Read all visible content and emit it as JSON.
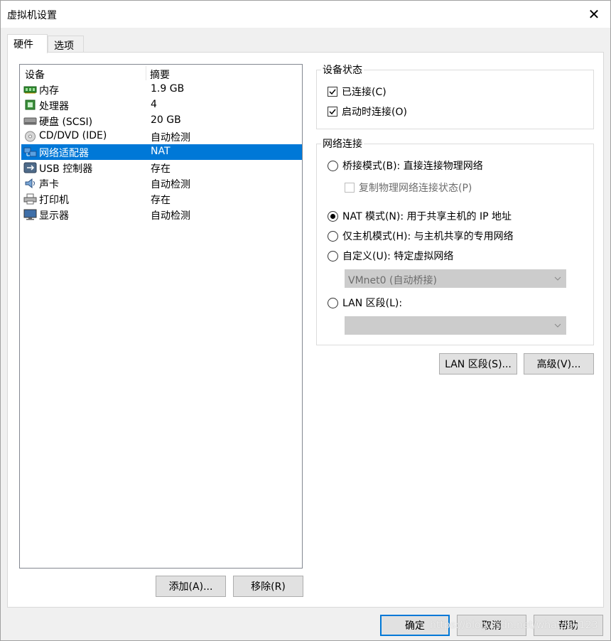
{
  "window": {
    "title": "虚拟机设置",
    "close_glyph": "✕"
  },
  "tabs": [
    {
      "label": "硬件"
    },
    {
      "label": "选项"
    }
  ],
  "device_list": {
    "headers": {
      "device": "设备",
      "summary": "摘要"
    },
    "rows": [
      {
        "name": "内存",
        "summary": "1.9 GB",
        "icon": "memory-icon"
      },
      {
        "name": "处理器",
        "summary": "4",
        "icon": "processor-icon"
      },
      {
        "name": "硬盘 (SCSI)",
        "summary": "20 GB",
        "icon": "harddisk-icon"
      },
      {
        "name": "CD/DVD (IDE)",
        "summary": "自动检测",
        "icon": "cd-dvd-icon"
      },
      {
        "name": "网络适配器",
        "summary": "NAT",
        "icon": "network-adapter-icon"
      },
      {
        "name": "USB 控制器",
        "summary": "存在",
        "icon": "usb-icon"
      },
      {
        "name": "声卡",
        "summary": "自动检测",
        "icon": "sound-icon"
      },
      {
        "name": "打印机",
        "summary": "存在",
        "icon": "printer-icon"
      },
      {
        "name": "显示器",
        "summary": "自动检测",
        "icon": "display-icon"
      }
    ],
    "selected_index": 4
  },
  "list_buttons": {
    "add": "添加(A)...",
    "remove": "移除(R)"
  },
  "device_status": {
    "title": "设备状态",
    "connected": {
      "label": "已连接(C)",
      "checked": true
    },
    "connect_on_power": {
      "label": "启动时连接(O)",
      "checked": true
    }
  },
  "network": {
    "title": "网络连接",
    "bridged": {
      "label": "桥接模式(B): 直接连接物理网络",
      "selected": false
    },
    "replicate": {
      "label": "复制物理网络连接状态(P)",
      "checked": false
    },
    "nat": {
      "label": "NAT 模式(N): 用于共享主机的 IP 地址",
      "selected": true
    },
    "host_only": {
      "label": "仅主机模式(H): 与主机共享的专用网络",
      "selected": false
    },
    "custom": {
      "label": "自定义(U): 特定虚拟网络",
      "selected": false
    },
    "custom_value": "VMnet0 (自动桥接)",
    "lan": {
      "label": "LAN 区段(L):",
      "selected": false
    },
    "lan_value": ""
  },
  "right_buttons": {
    "lan_segments": "LAN 区段(S)...",
    "advanced": "高级(V)..."
  },
  "footer_buttons": {
    "ok": "确定",
    "cancel": "取消",
    "help": "帮助"
  },
  "watermark": "https://blog.csdn.net/whatday123",
  "colors": {
    "selection": "#0078d7",
    "default_button_border": "#0078d7"
  }
}
